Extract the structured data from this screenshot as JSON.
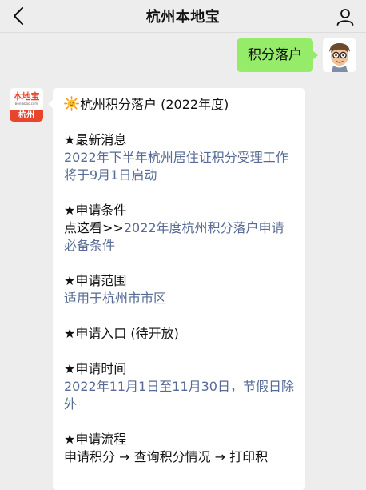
{
  "header": {
    "title": "杭州本地宝"
  },
  "outgoing": {
    "text": "积分落户"
  },
  "bot": {
    "logo_name": "本地宝",
    "logo_domain": "Bendibao.com",
    "logo_city": "杭州"
  },
  "message": {
    "title": "杭州积分落户 (2022年度)",
    "sections": [
      {
        "heading": "★最新消息",
        "link": "2022年下半年杭州居住证积分受理工作将于9月1日启动"
      },
      {
        "heading": "★申请条件",
        "prefix": "点这看>>",
        "link": "2022年度杭州积分落户申请必备条件"
      },
      {
        "heading": "★申请范围",
        "link": "适用于杭州市市区"
      },
      {
        "heading": "★申请入口 (待开放)"
      },
      {
        "heading": "★申请时间",
        "link": "2022年11月1日至11月30日，节假日除外"
      },
      {
        "heading": "★申请流程",
        "body": "申请积分 → 查询积分情况 → 打印积"
      }
    ]
  },
  "colors": {
    "background": "#ededed",
    "outgoing_bubble": "#95ec69",
    "link": "#576b95",
    "brand_red": "#e8452c"
  },
  "icons": {
    "back": "chevron-left-icon",
    "profile": "person-icon",
    "sun": "sun-emoji-icon"
  }
}
